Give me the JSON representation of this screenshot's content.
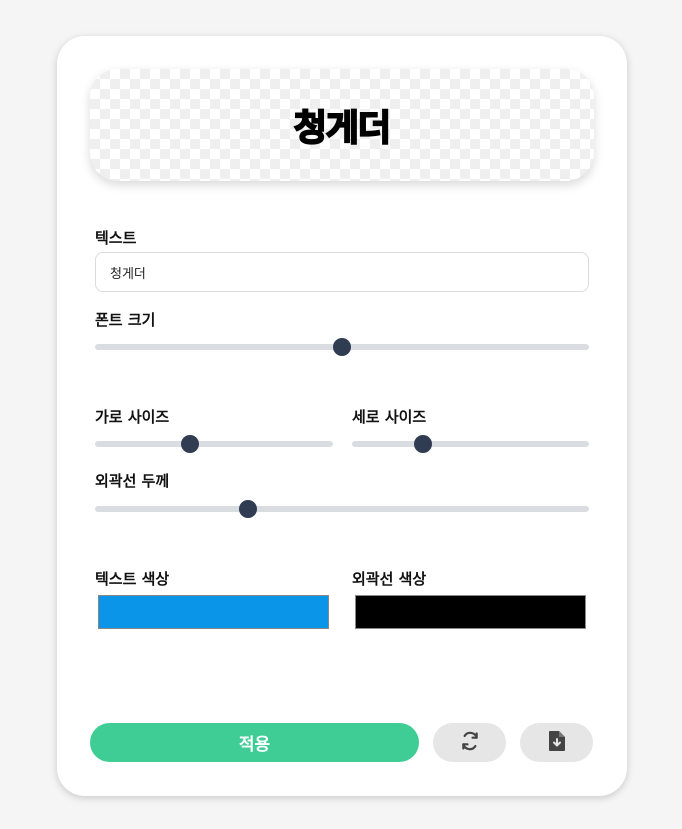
{
  "preview": {
    "text": "청게더",
    "text_color": "#0a95e8",
    "stroke_color": "#000000"
  },
  "text_field": {
    "label": "텍스트",
    "value": "청게더"
  },
  "font_size": {
    "label": "폰트 크기",
    "value_fraction": 0.5
  },
  "width_size": {
    "label": "가로 사이즈",
    "value_fraction": 0.4
  },
  "height_size": {
    "label": "세로 사이즈",
    "value_fraction": 0.3
  },
  "stroke_width": {
    "label": "외곽선 두께",
    "value_fraction": 0.31
  },
  "text_color": {
    "label": "텍스트 색상",
    "value": "#0a95e8"
  },
  "stroke_color": {
    "label": "외곽선 색상",
    "value": "#000000"
  },
  "actions": {
    "apply_label": "적용",
    "reset_icon": "refresh-icon",
    "download_icon": "file-download-icon"
  }
}
